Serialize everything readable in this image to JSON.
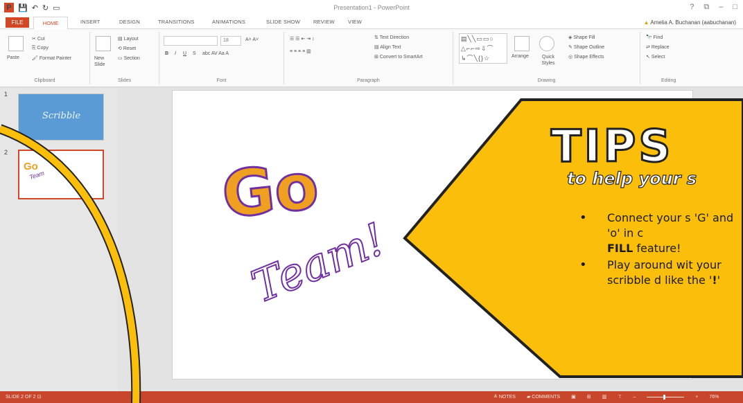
{
  "window": {
    "title": "Presentation1 - PowerPoint",
    "controls": [
      "?",
      "⧉",
      "–",
      "□"
    ]
  },
  "tabs": {
    "file": "FILE",
    "home": "HOME",
    "insert": "INSERT",
    "design": "DESIGN",
    "transitions": "TRANSITIONS",
    "animations": "ANIMATIONS",
    "slideshow": "SLIDE SHOW",
    "review": "REVIEW",
    "view": "VIEW"
  },
  "user": {
    "name": "Amelia A. Buchanan (aabuchanan)"
  },
  "ribbon": {
    "clipboard": {
      "label": "Clipboard",
      "paste": "Paste",
      "cut": "Cut",
      "copy": "Copy",
      "format_painter": "Format Painter"
    },
    "slides": {
      "label": "Slides",
      "new_slide": "New Slide",
      "layout": "Layout",
      "reset": "Reset",
      "section": "Section"
    },
    "font": {
      "label": "Font",
      "size": "18",
      "bold": "B",
      "italic": "I",
      "underline": "U",
      "strike": "S"
    },
    "paragraph": {
      "label": "Paragraph",
      "text_direction": "Text Direction",
      "align_text": "Align Text",
      "convert_smartart": "Convert to SmartArt"
    },
    "drawing": {
      "label": "Drawing",
      "arrange": "Arrange",
      "quick_styles": "Quick Styles",
      "shape_fill": "Shape Fill",
      "shape_outline": "Shape Outline",
      "shape_effects": "Shape Effects"
    },
    "editing": {
      "label": "Editing",
      "find": "Find",
      "replace": "Replace",
      "select": "Select"
    }
  },
  "thumbnails": [
    {
      "number": "1",
      "text": "Scribble"
    },
    {
      "number": "2",
      "text_a": "Go",
      "text_b": "Team"
    }
  ],
  "slide": {
    "scribble_go": "Go",
    "scribble_team": "Team!"
  },
  "tips": {
    "title": "TIPS",
    "subtitle": "to help your s",
    "items": [
      {
        "text": "Connect your s 'G' and 'o' in c",
        "bold": "FILL",
        "after": " feature!"
      },
      {
        "text": "Play around wit your scribble d like the '",
        "bold": "!",
        "after": "'"
      }
    ]
  },
  "statusbar": {
    "slide_info": "SLIDE 2 OF 2",
    "notes": "NOTES",
    "comments": "COMMENTS",
    "zoom": "76%"
  },
  "colors": {
    "accent": "#d24726",
    "tips_fill": "#fbbf0b",
    "arc": "#fbbf0b",
    "scribble_orange": "#f0a020",
    "scribble_purple": "#7030a0",
    "thumb_blue": "#5b9bd5"
  }
}
